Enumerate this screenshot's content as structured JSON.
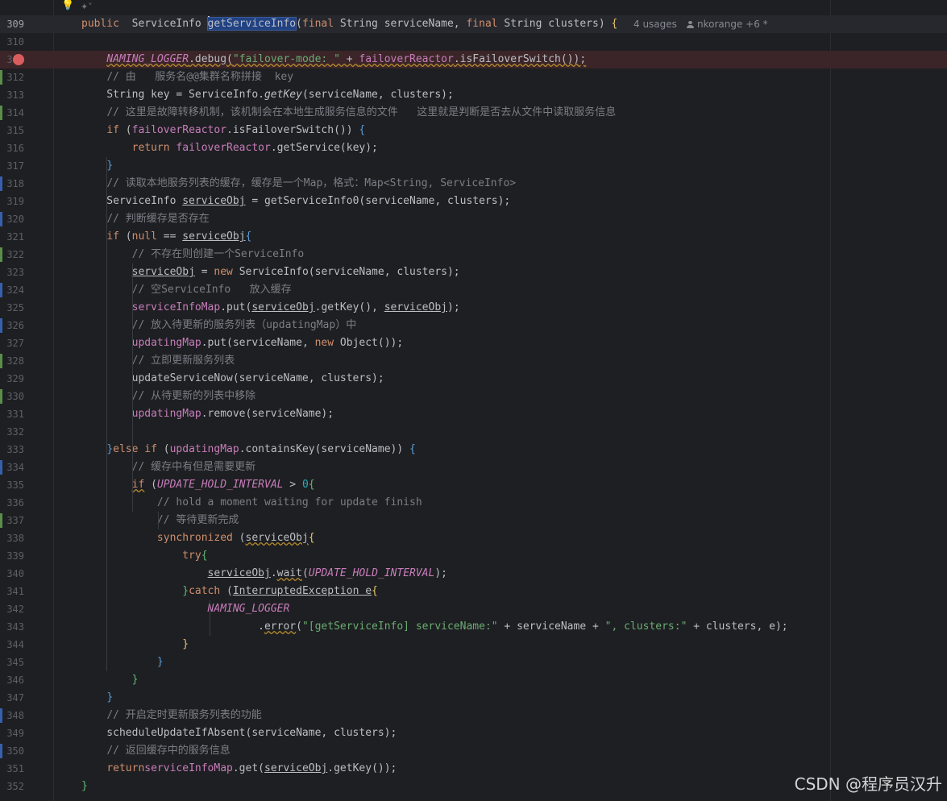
{
  "inlay": {
    "hint_glyph": "✦˅"
  },
  "current_line_hint": {
    "usages": "4 usages",
    "author": "nkorange +6 *"
  },
  "watermark": "CSDN @程序员汉升",
  "lines": [
    {
      "n": "309",
      "mark": "",
      "current": true,
      "seg": [
        [
          "kw",
          "public"
        ],
        [
          "",
          "  ServiceInfo "
        ],
        [
          "sel",
          "getServiceInfo"
        ],
        [
          "",
          "("
        ],
        [
          "kw",
          "final"
        ],
        [
          "",
          " String serviceName, "
        ],
        [
          "kw",
          "final"
        ],
        [
          "",
          " String clusters) "
        ],
        [
          "py",
          "{"
        ]
      ]
    },
    {
      "n": "310",
      "mark": "",
      "seg": []
    },
    {
      "n": "311",
      "mark": "",
      "bp": true,
      "seg": [
        [
          "",
          "    "
        ],
        [
          "cst wv",
          "NAMING_LOGGER"
        ],
        [
          "wv",
          ".debug"
        ],
        [
          "wv",
          "("
        ],
        [
          "str wv",
          "\"failover-mode: \""
        ],
        [
          "wv",
          " + "
        ],
        [
          "fld wv",
          "failoverReactor"
        ],
        [
          "wv",
          ".isFailoverSwitch"
        ],
        [
          "wv",
          "());"
        ]
      ]
    },
    {
      "n": "312",
      "mark": "added",
      "seg": [
        [
          "",
          "    "
        ],
        [
          "cm",
          "// 由   服务名@@集群名称拼接  key"
        ]
      ]
    },
    {
      "n": "313",
      "mark": "",
      "seg": [
        [
          "",
          "    String key = ServiceInfo."
        ],
        [
          "st",
          "getKey"
        ],
        [
          "",
          "(serviceName, clusters);"
        ]
      ]
    },
    {
      "n": "314",
      "mark": "added",
      "seg": [
        [
          "",
          "    "
        ],
        [
          "cm",
          "// 这里是故障转移机制，该机制会在本地生成服务信息的文件   这里就是判断是否去从文件中读取服务信息"
        ]
      ]
    },
    {
      "n": "315",
      "mark": "",
      "seg": [
        [
          "",
          "    "
        ],
        [
          "kw",
          "if"
        ],
        [
          "",
          " ("
        ],
        [
          "fld",
          "failoverReactor"
        ],
        [
          "",
          ".isFailoverSwitch()) "
        ],
        [
          "pb",
          "{"
        ]
      ]
    },
    {
      "n": "316",
      "mark": "",
      "seg": [
        [
          "",
          "        "
        ],
        [
          "kw",
          "return"
        ],
        [
          " ",
          ""
        ],
        [
          "fld",
          " failoverReactor"
        ],
        [
          "",
          ".getService(key);"
        ]
      ]
    },
    {
      "n": "317",
      "mark": "",
      "seg": [
        [
          "",
          "    "
        ],
        [
          "pb",
          "}"
        ]
      ]
    },
    {
      "n": "318",
      "mark": "modified",
      "seg": [
        [
          "",
          "    "
        ],
        [
          "cm",
          "// 读取本地服务列表的缓存，缓存是一个Map，格式：Map<String, ServiceInfo>"
        ]
      ]
    },
    {
      "n": "319",
      "mark": "",
      "seg": [
        [
          "",
          "    ServiceInfo "
        ],
        [
          "ul",
          "serviceObj"
        ],
        [
          "",
          " = getServiceInfo0(serviceName, clusters);"
        ]
      ]
    },
    {
      "n": "320",
      "mark": "modified",
      "seg": [
        [
          "",
          "    "
        ],
        [
          "cm",
          "// 判断缓存是否存在"
        ]
      ]
    },
    {
      "n": "321",
      "mark": "",
      "seg": [
        [
          "",
          "    "
        ],
        [
          "kw",
          "if"
        ],
        [
          "",
          " ("
        ],
        [
          "kw",
          "null"
        ],
        [
          "",
          " == "
        ],
        [
          "ul",
          "serviceObj"
        ],
        [
          ") "
        ],
        [
          "pb",
          "{"
        ]
      ]
    },
    {
      "n": "322",
      "mark": "added",
      "seg": [
        [
          "",
          "        "
        ],
        [
          "cm",
          "// 不存在则创建一个ServiceInfo"
        ]
      ]
    },
    {
      "n": "323",
      "mark": "",
      "seg": [
        [
          "",
          "        "
        ],
        [
          "ul",
          "serviceObj"
        ],
        [
          "",
          " = "
        ],
        [
          "kw",
          "new"
        ],
        [
          "",
          " ServiceInfo(serviceName, clusters);"
        ]
      ]
    },
    {
      "n": "324",
      "mark": "modified",
      "seg": [
        [
          "",
          "        "
        ],
        [
          "cm",
          "// 空ServiceInfo   放入缓存"
        ]
      ]
    },
    {
      "n": "325",
      "mark": "",
      "seg": [
        [
          "",
          "        "
        ],
        [
          "fld",
          "serviceInfoMap"
        ],
        [
          "",
          ".put("
        ],
        [
          "ul",
          "serviceObj"
        ],
        [
          "",
          ".getKey(), "
        ],
        [
          "ul",
          "serviceObj"
        ],
        [
          "",
          ");"
        ]
      ]
    },
    {
      "n": "326",
      "mark": "modified",
      "seg": [
        [
          "",
          "        "
        ],
        [
          "cm",
          "// 放入待更新的服务列表（updatingMap）中"
        ]
      ]
    },
    {
      "n": "327",
      "mark": "",
      "seg": [
        [
          "",
          "        "
        ],
        [
          "fld",
          "updatingMap"
        ],
        [
          "",
          ".put(serviceName, "
        ],
        [
          "kw",
          "new"
        ],
        [
          "",
          " Object());"
        ]
      ]
    },
    {
      "n": "328",
      "mark": "added",
      "seg": [
        [
          "",
          "        "
        ],
        [
          "cm",
          "// 立即更新服务列表"
        ]
      ]
    },
    {
      "n": "329",
      "mark": "",
      "seg": [
        [
          "",
          "        updateServiceNow(serviceName, clusters);"
        ]
      ]
    },
    {
      "n": "330",
      "mark": "added",
      "seg": [
        [
          "",
          "        "
        ],
        [
          "cm",
          "// 从待更新的列表中移除"
        ]
      ]
    },
    {
      "n": "331",
      "mark": "",
      "seg": [
        [
          "",
          "        "
        ],
        [
          "fld",
          "updatingMap"
        ],
        [
          "",
          ".remove(serviceName);"
        ]
      ]
    },
    {
      "n": "332",
      "mark": "",
      "seg": []
    },
    {
      "n": "333",
      "mark": "",
      "seg": [
        [
          "",
          "    "
        ],
        [
          "pb",
          "}"
        ],
        [
          " "
        ],
        [
          "kw",
          "else if"
        ],
        [
          "",
          " ("
        ],
        [
          "fld",
          "updatingMap"
        ],
        [
          "",
          ".containsKey(serviceName)) "
        ],
        [
          "pb",
          "{"
        ]
      ]
    },
    {
      "n": "334",
      "mark": "modified",
      "seg": [
        [
          "",
          "        "
        ],
        [
          "cm",
          "// 缓存中有但是需要更新"
        ]
      ]
    },
    {
      "n": "335",
      "mark": "",
      "seg": [
        [
          "",
          "        "
        ],
        [
          "kw wv",
          "if"
        ],
        [
          "",
          " ("
        ],
        [
          "cst",
          "UPDATE_HOLD_INTERVAL"
        ],
        [
          "",
          " > "
        ],
        [
          "num",
          "0"
        ],
        [
          ") "
        ],
        [
          "pg",
          "{"
        ]
      ]
    },
    {
      "n": "336",
      "mark": "",
      "seg": [
        [
          "",
          "            "
        ],
        [
          "cm",
          "// hold a moment waiting for update finish"
        ]
      ]
    },
    {
      "n": "337",
      "mark": "added",
      "seg": [
        [
          "",
          "            "
        ],
        [
          "cm",
          "// 等待更新完成"
        ]
      ]
    },
    {
      "n": "338",
      "mark": "",
      "seg": [
        [
          "",
          "            "
        ],
        [
          "kw",
          "synchronized"
        ],
        [
          "",
          " ("
        ],
        [
          "ul wv",
          "serviceObj"
        ],
        [
          ") "
        ],
        [
          "py",
          "{"
        ]
      ]
    },
    {
      "n": "339",
      "mark": "",
      "seg": [
        [
          "",
          "                "
        ],
        [
          "kw",
          "try"
        ],
        [
          " "
        ],
        [
          "pg",
          "{"
        ]
      ]
    },
    {
      "n": "340",
      "mark": "",
      "seg": [
        [
          "",
          "                    "
        ],
        [
          "ul",
          "serviceObj"
        ],
        [
          "",
          "."
        ],
        [
          "wv",
          "wait"
        ],
        [
          "",
          "("
        ],
        [
          "cst",
          "UPDATE_HOLD_INTERVAL"
        ],
        [
          "",
          ");"
        ]
      ]
    },
    {
      "n": "341",
      "mark": "",
      "seg": [
        [
          "",
          "                "
        ],
        [
          "pg",
          "}"
        ],
        [
          " "
        ],
        [
          "kw",
          "catch"
        ],
        [
          "",
          " ("
        ],
        [
          "ul",
          "InterruptedException e"
        ],
        [
          ") "
        ],
        [
          "py",
          "{"
        ]
      ]
    },
    {
      "n": "342",
      "mark": "",
      "seg": [
        [
          "",
          "                    "
        ],
        [
          "cst",
          "NAMING_LOGGER"
        ]
      ]
    },
    {
      "n": "343",
      "mark": "",
      "seg": [
        [
          "",
          "                            ."
        ],
        [
          "wv",
          "error"
        ],
        [
          "",
          "("
        ],
        [
          "str",
          "\"[getServiceInfo] serviceName:\""
        ],
        [
          "",
          " + serviceName + "
        ],
        [
          "str",
          "\", clusters:\""
        ],
        [
          "",
          " + clusters, e);"
        ]
      ]
    },
    {
      "n": "344",
      "mark": "",
      "seg": [
        [
          "",
          "                "
        ],
        [
          "py",
          "}"
        ]
      ]
    },
    {
      "n": "345",
      "mark": "",
      "seg": [
        [
          "",
          "            "
        ],
        [
          "pb",
          "}"
        ]
      ]
    },
    {
      "n": "346",
      "mark": "",
      "seg": [
        [
          "",
          "        "
        ],
        [
          "pg",
          "}"
        ]
      ]
    },
    {
      "n": "347",
      "mark": "",
      "seg": [
        [
          "",
          "    "
        ],
        [
          "pb",
          "}"
        ]
      ]
    },
    {
      "n": "348",
      "mark": "modified",
      "seg": [
        [
          "",
          "    "
        ],
        [
          "cm",
          "// 开启定时更新服务列表的功能"
        ]
      ]
    },
    {
      "n": "349",
      "mark": "",
      "seg": [
        [
          "",
          "    scheduleUpdateIfAbsent(serviceName, clusters);"
        ]
      ]
    },
    {
      "n": "350",
      "mark": "modified",
      "seg": [
        [
          "",
          "    "
        ],
        [
          "cm",
          "// 返回缓存中的服务信息"
        ]
      ]
    },
    {
      "n": "351",
      "mark": "",
      "seg": [
        [
          "",
          "    "
        ],
        [
          "kw",
          "return"
        ],
        [
          " "
        ],
        [
          "fld",
          "serviceInfoMap"
        ],
        [
          "",
          ".get("
        ],
        [
          "ul",
          "serviceObj"
        ],
        [
          "",
          ".getKey());"
        ]
      ]
    },
    {
      "n": "352",
      "mark": "",
      "seg": [
        [
          "pg",
          "}"
        ]
      ]
    }
  ]
}
